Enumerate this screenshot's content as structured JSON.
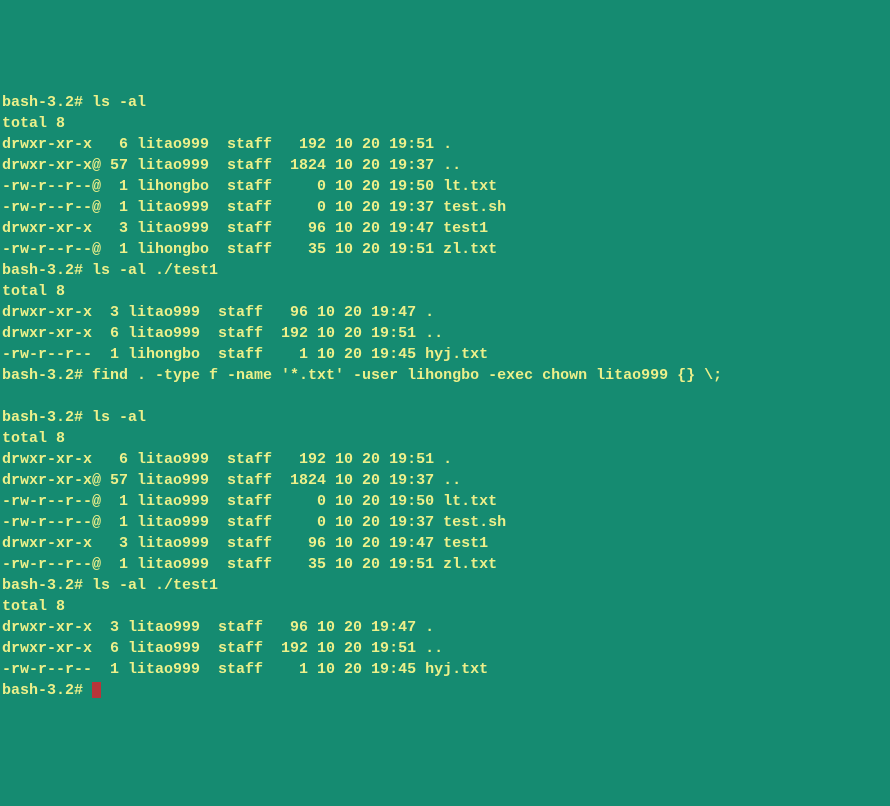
{
  "lines": [
    "bash-3.2# ls -al",
    "total 8",
    "drwxr-xr-x   6 litao999  staff   192 10 20 19:51 .",
    "drwxr-xr-x@ 57 litao999  staff  1824 10 20 19:37 ..",
    "-rw-r--r--@  1 lihongbo  staff     0 10 20 19:50 lt.txt",
    "-rw-r--r--@  1 litao999  staff     0 10 20 19:37 test.sh",
    "drwxr-xr-x   3 litao999  staff    96 10 20 19:47 test1",
    "-rw-r--r--@  1 lihongbo  staff    35 10 20 19:51 zl.txt",
    "bash-3.2# ls -al ./test1",
    "total 8",
    "drwxr-xr-x  3 litao999  staff   96 10 20 19:47 .",
    "drwxr-xr-x  6 litao999  staff  192 10 20 19:51 ..",
    "-rw-r--r--  1 lihongbo  staff    1 10 20 19:45 hyj.txt",
    "bash-3.2# find . -type f -name '*.txt' -user lihongbo -exec chown litao999 {} \\;",
    "",
    "bash-3.2# ls -al",
    "total 8",
    "drwxr-xr-x   6 litao999  staff   192 10 20 19:51 .",
    "drwxr-xr-x@ 57 litao999  staff  1824 10 20 19:37 ..",
    "-rw-r--r--@  1 litao999  staff     0 10 20 19:50 lt.txt",
    "-rw-r--r--@  1 litao999  staff     0 10 20 19:37 test.sh",
    "drwxr-xr-x   3 litao999  staff    96 10 20 19:47 test1",
    "-rw-r--r--@  1 litao999  staff    35 10 20 19:51 zl.txt",
    "bash-3.2# ls -al ./test1",
    "total 8",
    "drwxr-xr-x  3 litao999  staff   96 10 20 19:47 .",
    "drwxr-xr-x  6 litao999  staff  192 10 20 19:51 ..",
    "-rw-r--r--  1 litao999  staff    1 10 20 19:45 hyj.txt"
  ],
  "prompt": "bash-3.2# "
}
